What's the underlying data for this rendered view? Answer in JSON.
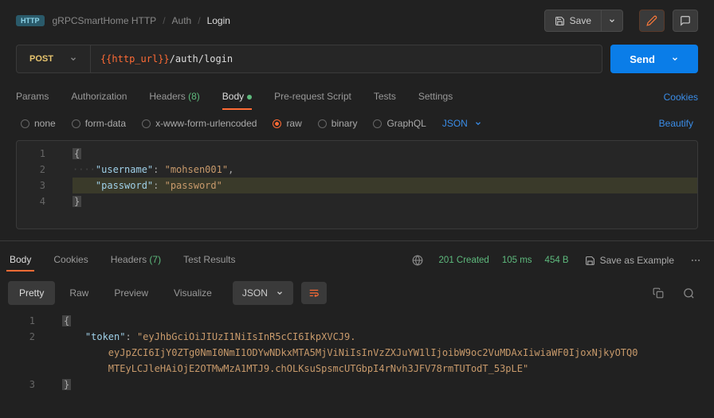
{
  "header": {
    "badge": "HTTP",
    "breadcrumb": [
      "gRPCSmartHome HTTP",
      "Auth",
      "Login"
    ],
    "save_label": "Save"
  },
  "request": {
    "method": "POST",
    "url_var": "{{http_url}}",
    "url_path": "/auth/login",
    "send_label": "Send"
  },
  "tabs": {
    "params": "Params",
    "auth": "Authorization",
    "headers": "Headers",
    "headers_count": "(8)",
    "body": "Body",
    "prereq": "Pre-request Script",
    "tests": "Tests",
    "settings": "Settings",
    "cookies": "Cookies"
  },
  "body_types": {
    "none": "none",
    "form": "form-data",
    "urlenc": "x-www-form-urlencoded",
    "raw": "raw",
    "binary": "binary",
    "graphql": "GraphQL",
    "json": "JSON",
    "beautify": "Beautify"
  },
  "req_body": {
    "line1_brace": "{",
    "line2_key": "\"username\"",
    "line2_val": "\"mohsen001\"",
    "line3_key": "\"password\"",
    "line3_val": "\"password\"",
    "line4_brace": "}"
  },
  "resp_tabs": {
    "body": "Body",
    "cookies": "Cookies",
    "headers": "Headers",
    "headers_count": "(7)",
    "tests": "Test Results"
  },
  "resp_meta": {
    "status": "201 Created",
    "time": "105 ms",
    "size": "454 B",
    "save_example": "Save as Example"
  },
  "view": {
    "pretty": "Pretty",
    "raw": "Raw",
    "preview": "Preview",
    "visualize": "Visualize",
    "json": "JSON"
  },
  "resp_body": {
    "brace_open": "{",
    "token_key": "\"token\"",
    "token_val1": "\"eyJhbGciOiJIUzI1NiIsInR5cCI6IkpXVCJ9.",
    "token_val2": "eyJpZCI6IjY0ZTg0NmI0NmI1ODYwNDkxMTA5MjViNiIsInVzZXJuYW1lIjoibW9oc2VuMDAxIiwiaWF0IjoxNjkyOTQ0",
    "token_val3": "MTEyLCJleHAiOjE2OTMwMzA1MTJ9.chOLKsuSpsmcUTGbpI4rNvh3JFV78rmTUTodT_53pLE\"",
    "brace_close": "}"
  }
}
